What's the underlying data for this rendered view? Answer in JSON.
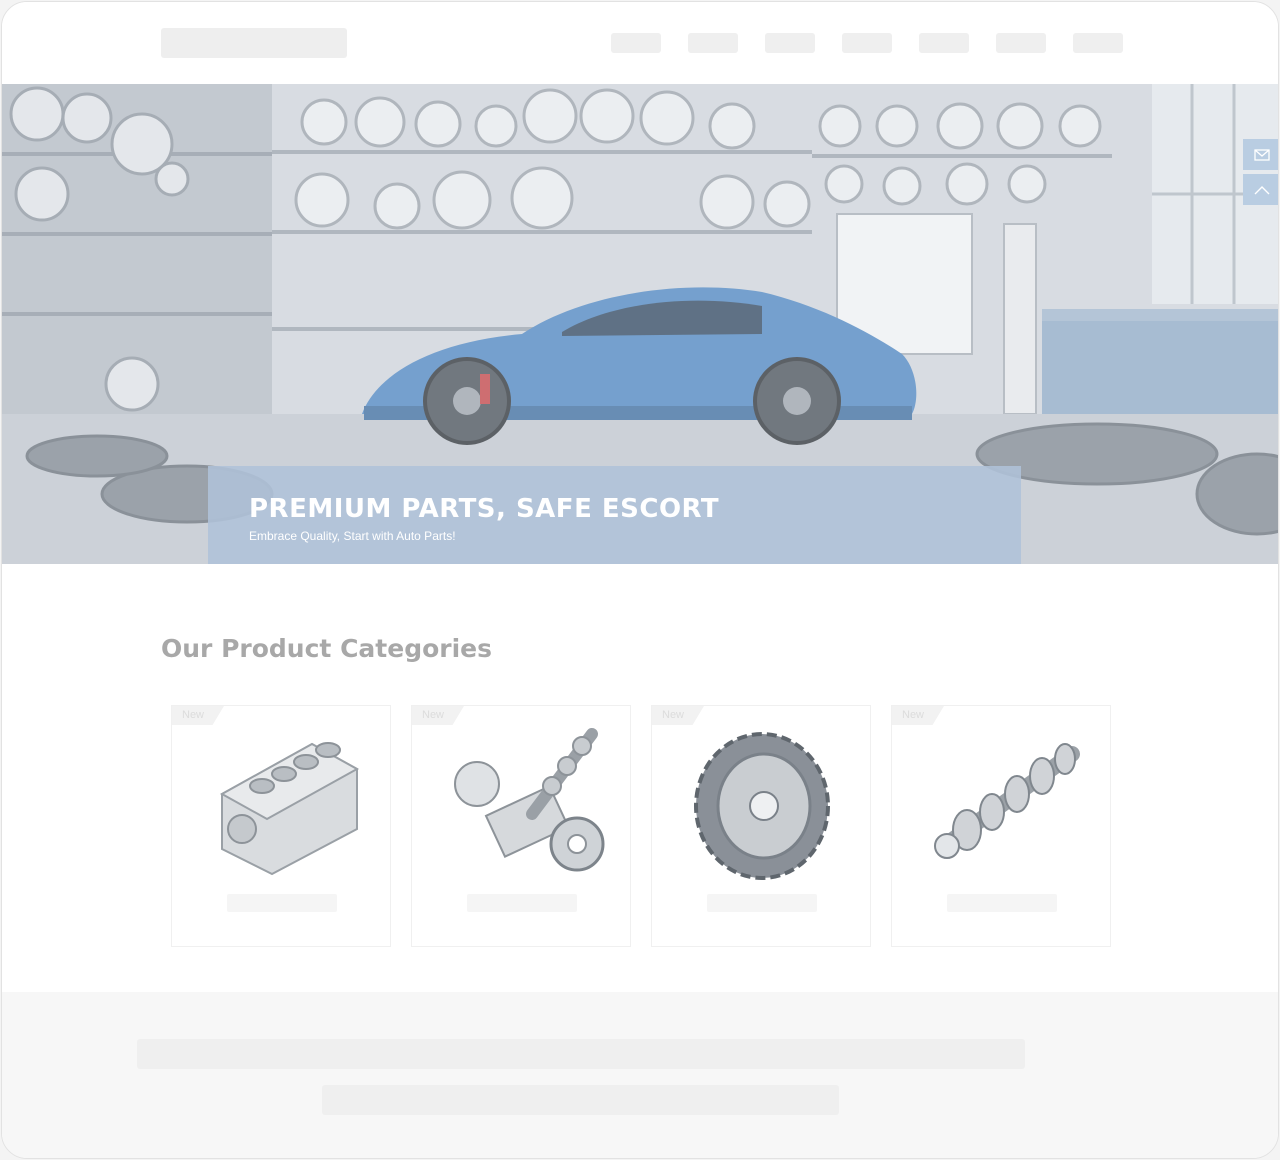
{
  "hero": {
    "title": "PREMIUM PARTS, SAFE ESCORT",
    "subtitle": "Embrace Quality, Start with Auto Parts!"
  },
  "floating_actions": [
    {
      "icon": "mail-icon"
    },
    {
      "icon": "chevron-up-icon"
    }
  ],
  "categories": {
    "title": "Our Product Categories",
    "items": [
      {
        "badge": "New",
        "image": "engine-block"
      },
      {
        "badge": "New",
        "image": "camshaft-assembly"
      },
      {
        "badge": "New",
        "image": "gear-wheel"
      },
      {
        "badge": "New",
        "image": "crankshaft"
      }
    ]
  },
  "colors": {
    "caption_background": "#afc1d8",
    "car_body": "#4f86c0",
    "section_title": "#a8a8a8",
    "floating_button": "#b9cde2"
  }
}
